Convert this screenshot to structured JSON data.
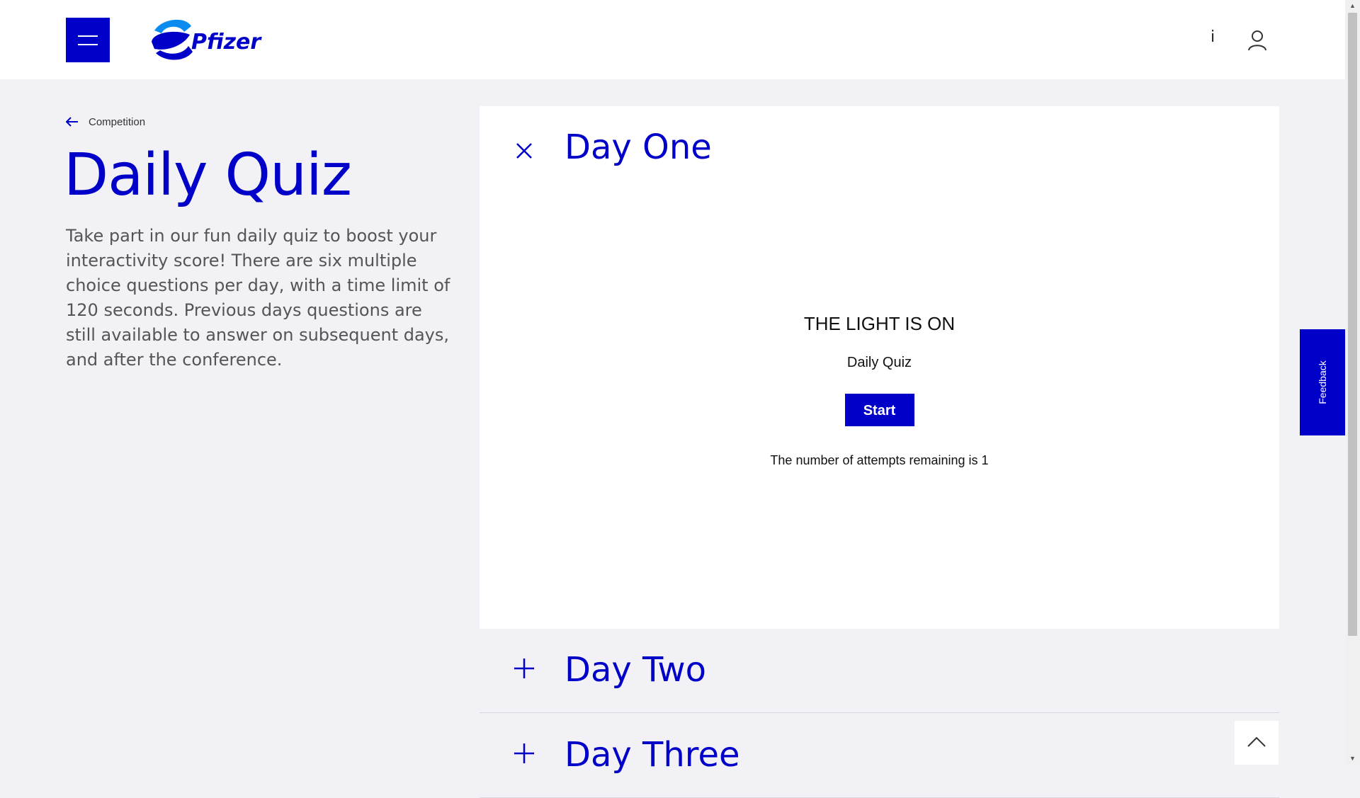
{
  "header": {
    "logo_text": "Pfizer",
    "info_label": "i"
  },
  "breadcrumb": {
    "label": "Competition"
  },
  "page": {
    "title": "Daily Quiz",
    "intro": "Take part in our fun daily quiz to boost your interactivity score! There are six multiple choice questions per day, with a time limit of 120 seconds. Previous days questions are still available to answer on subsequent days, and after the conference."
  },
  "accordion": [
    {
      "title": "Day One",
      "expanded": true,
      "quiz": {
        "heading": "THE LIGHT IS ON",
        "subtitle": "Daily Quiz",
        "start_label": "Start",
        "attempts_text": "The number of attempts remaining is 1"
      }
    },
    {
      "title": "Day Two",
      "expanded": false
    },
    {
      "title": "Day Three",
      "expanded": false
    }
  ],
  "feedback": {
    "label": "Feedback"
  },
  "colors": {
    "brand": "#0000c9",
    "background": "#f1f1f6"
  }
}
